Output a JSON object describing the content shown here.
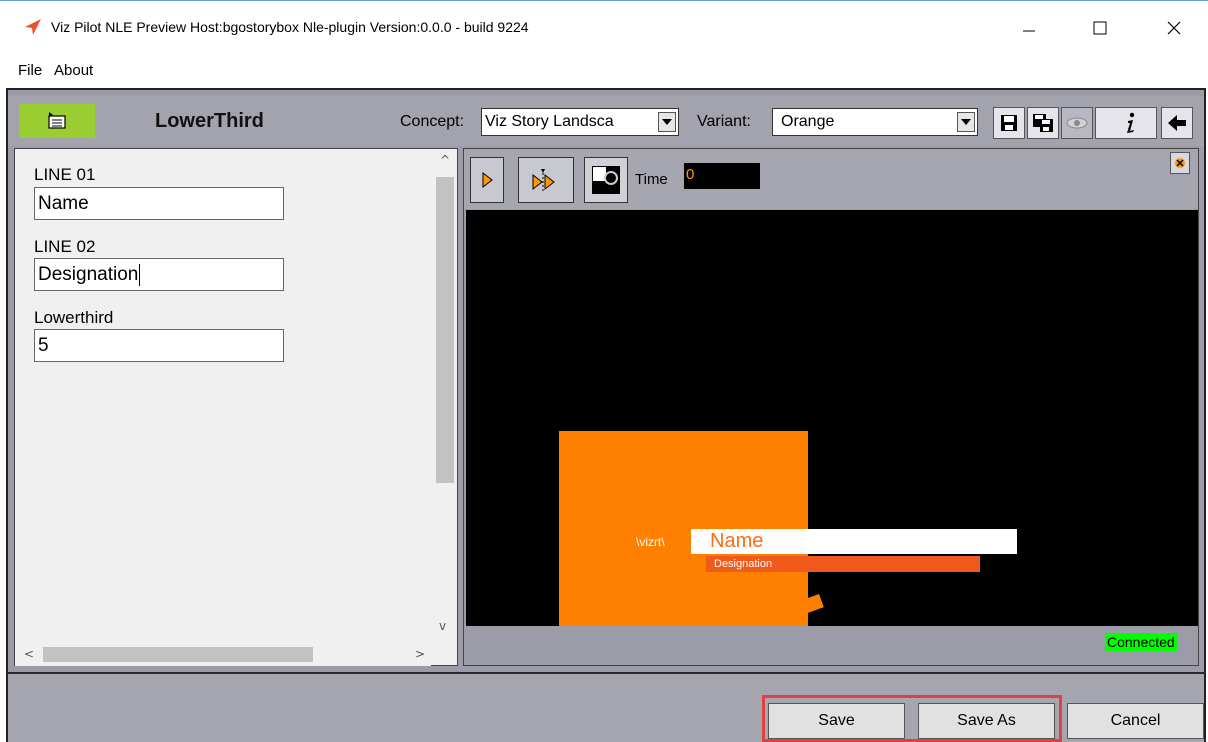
{
  "window": {
    "title": "Viz Pilot NLE   Preview Host:bgostorybox  Nle-plugin Version:0.0.0 - build 9224"
  },
  "menu": {
    "file": "File",
    "about": "About"
  },
  "toolbar": {
    "template_name": "LowerThird",
    "concept_label": "Concept:",
    "concept_value": "Viz Story Landsca",
    "variant_label": "Variant:",
    "variant_value": "Orange",
    "icons": [
      "save-icon",
      "save-as-icon",
      "eye-icon",
      "info-icon",
      "back-arrow-icon"
    ]
  },
  "form": {
    "fields": [
      {
        "label": "LINE 01",
        "value": "Name"
      },
      {
        "label": "LINE 02",
        "value": "Designation"
      },
      {
        "label": "Lowerthird",
        "value": "5"
      }
    ]
  },
  "preview": {
    "time_label": "Time",
    "time_value": "0",
    "vizrt_logo": "\\vizrt\\",
    "name_text": "Name",
    "designation_text": "Designation",
    "status": "Connected",
    "accent_color": "#ff7f00",
    "status_color": "#00ff00"
  },
  "actions": {
    "save": "Save",
    "save_as": "Save As",
    "cancel": "Cancel"
  }
}
